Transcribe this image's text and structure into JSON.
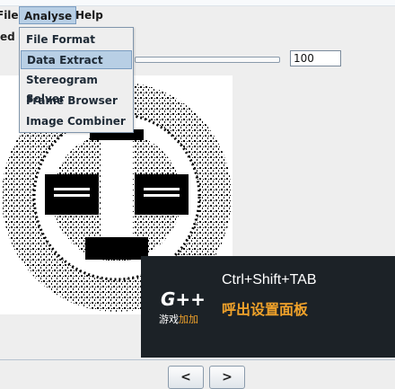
{
  "menubar": {
    "items": [
      {
        "label": "File"
      },
      {
        "label": "Analyse"
      },
      {
        "label": "Help"
      }
    ]
  },
  "subtitle": "ed p",
  "value_field": "100",
  "analyse_menu": {
    "items": [
      {
        "label": "File Format",
        "selected": false
      },
      {
        "label": "Data Extract",
        "selected": true
      },
      {
        "label": "Stereogram Solver",
        "selected": false
      },
      {
        "label": "Frame Browser",
        "selected": false
      },
      {
        "label": "Image Combiner",
        "selected": false
      }
    ]
  },
  "overlay": {
    "logo_text": "G++",
    "logo_caption_prefix": "游戏",
    "logo_caption_accent": "加加",
    "shortcut": "Ctrl+Shift+TAB",
    "action": "呼出设置面板"
  },
  "nav": {
    "prev": "<",
    "next": ">"
  }
}
